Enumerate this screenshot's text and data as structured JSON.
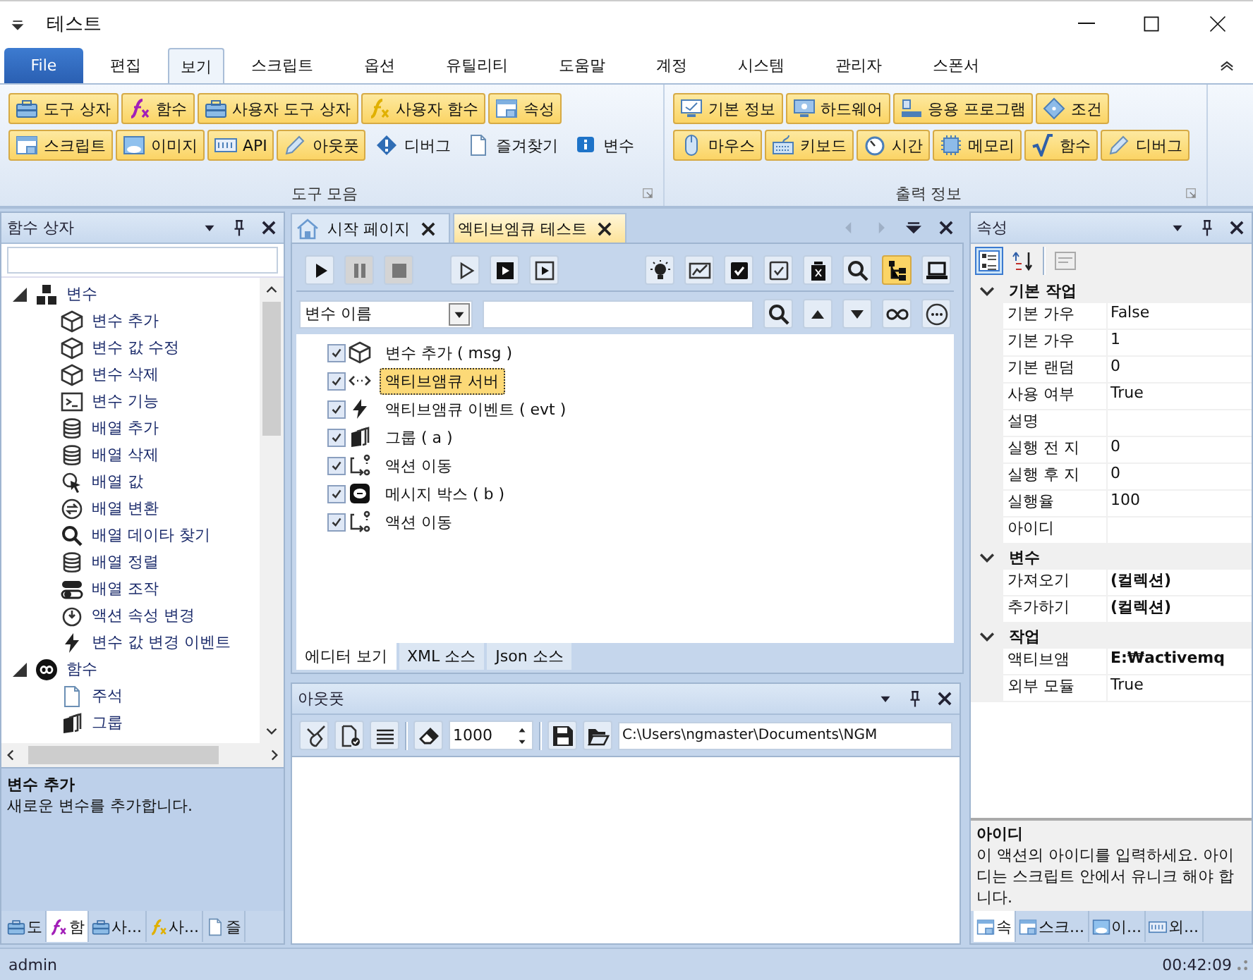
{
  "window": {
    "title": "테스트"
  },
  "menu_tabs": [
    {
      "label": "File",
      "kind": "file",
      "selected": false
    },
    {
      "label": "편집",
      "kind": "tab",
      "selected": false
    },
    {
      "label": "보기",
      "kind": "tab",
      "selected": true
    },
    {
      "label": "스크립트",
      "kind": "tab",
      "selected": false
    },
    {
      "label": "옵션",
      "kind": "tab",
      "selected": false
    },
    {
      "label": "유틸리티",
      "kind": "tab",
      "selected": false
    },
    {
      "label": "도움말",
      "kind": "tab",
      "selected": false
    },
    {
      "label": "계정",
      "kind": "tab",
      "selected": false
    },
    {
      "label": "시스템",
      "kind": "tab",
      "selected": false
    },
    {
      "label": "관리자",
      "kind": "tab",
      "selected": false
    },
    {
      "label": "스폰서",
      "kind": "tab",
      "selected": false
    }
  ],
  "ribbon": {
    "groups": [
      {
        "title": "도구 모음",
        "rows": [
          {
            "buttons": [
              {
                "label": "도구 상자",
                "checked": true
              },
              {
                "label": "함수",
                "checked": true
              },
              {
                "label": "사용자 도구 상자",
                "checked": true
              },
              {
                "label": "사용자 함수",
                "checked": true
              },
              {
                "label": "속성",
                "checked": true
              }
            ]
          },
          {
            "buttons": [
              {
                "label": "스크립트",
                "checked": true
              },
              {
                "label": "이미지",
                "checked": true
              },
              {
                "label": "API",
                "checked": true
              },
              {
                "label": "아웃풋",
                "checked": true
              },
              {
                "label": "디버그",
                "checked": false
              },
              {
                "label": "즐겨찾기",
                "checked": false
              },
              {
                "label": "변수",
                "checked": false
              }
            ]
          }
        ]
      },
      {
        "title": "출력 정보",
        "rows": [
          {
            "buttons": [
              {
                "label": "기본 정보",
                "checked": true
              },
              {
                "label": "하드웨어",
                "checked": true
              },
              {
                "label": "응용 프로그램",
                "checked": true
              },
              {
                "label": "조건",
                "checked": true
              }
            ]
          },
          {
            "buttons": [
              {
                "label": "마우스",
                "checked": true
              },
              {
                "label": "키보드",
                "checked": true
              },
              {
                "label": "시간",
                "checked": true
              },
              {
                "label": "메모리",
                "checked": true
              },
              {
                "label": "함수",
                "checked": true
              },
              {
                "label": "디버그",
                "checked": true
              }
            ]
          }
        ]
      }
    ]
  },
  "function_box": {
    "title": "함수 상자",
    "tree": [
      {
        "label": "변수",
        "expanded": true,
        "children": [
          {
            "label": "변수 추가"
          },
          {
            "label": "변수 값 수정"
          },
          {
            "label": "변수 삭제"
          },
          {
            "label": "변수 기능"
          },
          {
            "label": "배열 추가"
          },
          {
            "label": "배열 삭제"
          },
          {
            "label": "배열 값"
          },
          {
            "label": "배열 변환"
          },
          {
            "label": "배열 데이타 찾기"
          },
          {
            "label": "배열 정렬"
          },
          {
            "label": "배열 조작"
          },
          {
            "label": "액션 속성 변경"
          },
          {
            "label": "변수 값 변경 이벤트"
          }
        ]
      },
      {
        "label": "함수",
        "expanded": true,
        "children": [
          {
            "label": "주석"
          },
          {
            "label": "그룹"
          }
        ]
      }
    ],
    "description": {
      "title": "변수 추가",
      "text": "새로운 변수를 추가합니다."
    },
    "tabs": [
      {
        "label": "도",
        "selected": false
      },
      {
        "label": "함",
        "selected": true
      },
      {
        "label": "사...",
        "selected": false
      },
      {
        "label": "사...",
        "selected": false
      },
      {
        "label": "즐",
        "selected": false
      }
    ]
  },
  "document_tabs": [
    {
      "label": "시작 페이지",
      "selected": false
    },
    {
      "label": "엑티브엠큐 테스트",
      "selected": true
    }
  ],
  "editor": {
    "toolbar": [
      {
        "disabled": false,
        "selected": false
      },
      {
        "disabled": true,
        "selected": false
      },
      {
        "disabled": true,
        "selected": false
      },
      {
        "disabled": false,
        "selected": false
      },
      {
        "disabled": false,
        "selected": false
      },
      {
        "disabled": false,
        "selected": false
      },
      {
        "disabled": false,
        "selected": false
      },
      {
        "disabled": false,
        "selected": false
      },
      {
        "disabled": false,
        "selected": false
      },
      {
        "disabled": false,
        "selected": false
      },
      {
        "disabled": false,
        "selected": false
      },
      {
        "disabled": false,
        "selected": false
      },
      {
        "disabled": false,
        "selected": true
      },
      {
        "disabled": false,
        "selected": false
      }
    ],
    "search_field": "변수 이름",
    "actions": [
      {
        "label": "변수 추가 ( msg )",
        "checked": true,
        "selected": false
      },
      {
        "label": "액티브앰큐 서버",
        "checked": true,
        "selected": true
      },
      {
        "label": "액티브앰큐 이벤트 ( evt )",
        "checked": true,
        "selected": false
      },
      {
        "label": "그룹 ( a )",
        "checked": true,
        "selected": false
      },
      {
        "label": "액션 이동",
        "checked": true,
        "selected": false
      },
      {
        "label": "메시지 박스 ( b )",
        "checked": true,
        "selected": false
      },
      {
        "label": "액션 이동",
        "checked": true,
        "selected": false
      }
    ],
    "view_tabs": [
      {
        "label": "에디터 보기",
        "selected": true
      },
      {
        "label": "XML 소스",
        "selected": false
      },
      {
        "label": "Json 소스",
        "selected": false
      }
    ]
  },
  "output": {
    "title": "아웃풋",
    "line_count": "1000",
    "path": "C:\\Users\\ngmaster\\Documents\\NGM"
  },
  "properties": {
    "title": "속성",
    "categories": [
      {
        "name": "기본 작업",
        "expanded": true,
        "rows": [
          {
            "name": "기본 가우",
            "value": "False",
            "bold": false
          },
          {
            "name": "기본 가우",
            "value": "1",
            "bold": false
          },
          {
            "name": "기본 랜덤",
            "value": "0",
            "bold": false
          },
          {
            "name": "사용 여부",
            "value": "True",
            "bold": false
          },
          {
            "name": "설명",
            "bold": false
          },
          {
            "name": "실행 전 지",
            "value": "0",
            "bold": false
          },
          {
            "name": "실행 후 지",
            "value": "0",
            "bold": false
          },
          {
            "name": "실행율",
            "value": "100",
            "bold": false
          },
          {
            "name": "아이디",
            "bold": false
          }
        ]
      },
      {
        "name": "변수",
        "expanded": true,
        "rows": [
          {
            "name": "가져오기",
            "value": "(컬렉션)",
            "bold": true
          },
          {
            "name": "추가하기",
            "value": "(컬렉션)",
            "bold": true
          }
        ]
      },
      {
        "name": "작업",
        "expanded": true,
        "rows": [
          {
            "name": "액티브앰",
            "value": "E:₩activemq",
            "bold": true
          },
          {
            "name": "외부 모듈",
            "value": "True",
            "bold": false
          }
        ]
      }
    ],
    "description": {
      "title": "아이디",
      "text": "이 액션의 아이디를 입력하세요. 아이디는 스크립트 안에서 유니크 해야 합니다."
    },
    "tabs": [
      {
        "label": "속",
        "selected": true
      },
      {
        "label": "스크...",
        "selected": false
      },
      {
        "label": "이...",
        "selected": false
      },
      {
        "label": "외...",
        "selected": false
      }
    ]
  },
  "status_bar": {
    "user": "admin",
    "time": "00:42:09"
  }
}
